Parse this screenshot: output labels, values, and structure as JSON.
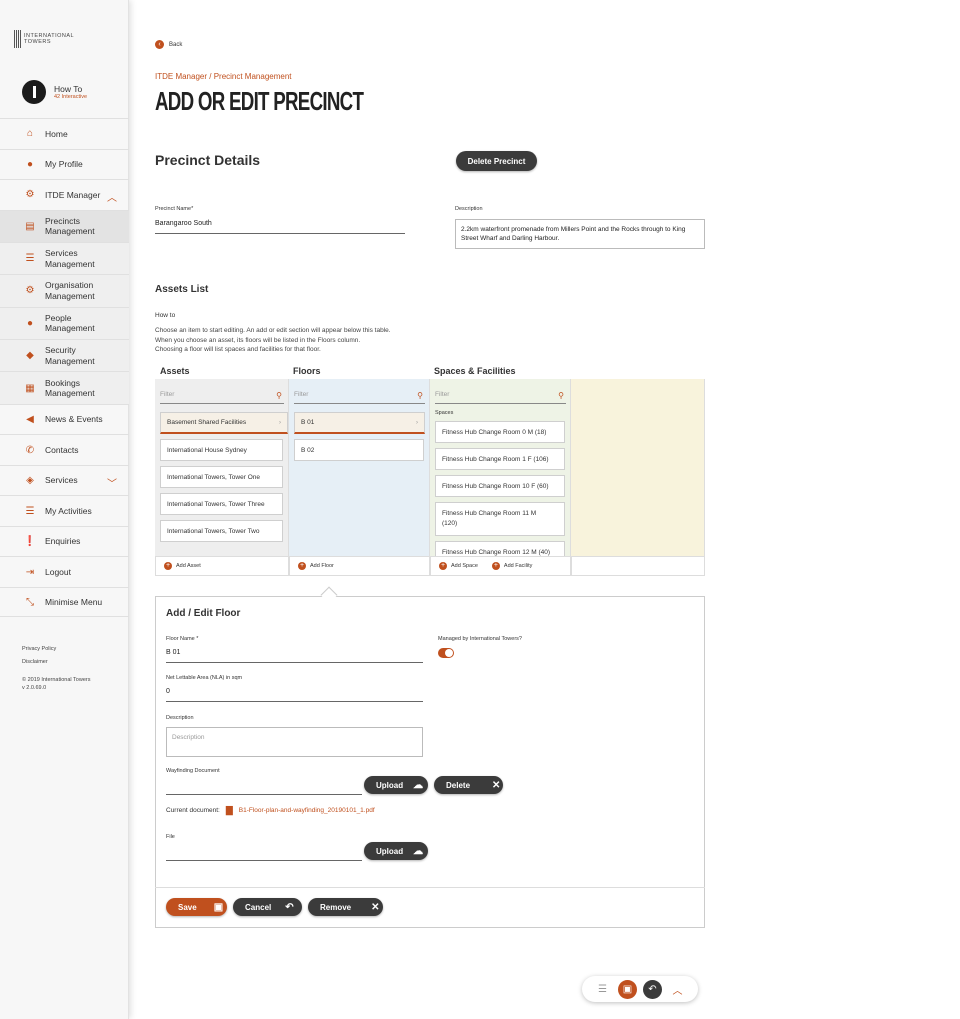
{
  "brand": {
    "logo_text_1": "INTERNATIONAL",
    "logo_text_2": "TOWERS"
  },
  "user": {
    "name": "How To",
    "org": "42 Interactive"
  },
  "nav": {
    "home": "Home",
    "profile": "My Profile",
    "itde": "ITDE Manager",
    "precincts_1": "Precincts",
    "precincts_2": "Management",
    "services_1": "Services",
    "services_2": "Management",
    "org_1": "Organisation",
    "org_2": "Management",
    "people_1": "People",
    "people_2": "Management",
    "security_1": "Security",
    "security_2": "Management",
    "bookings_1": "Bookings",
    "bookings_2": "Management",
    "news": "News & Events",
    "contacts": "Contacts",
    "services": "Services",
    "activities": "My Activities",
    "enquiries": "Enquiries",
    "logout": "Logout",
    "minimise": "Minimise Menu"
  },
  "footer": {
    "privacy": "Privacy Policy",
    "disclaimer": "Disclaimer",
    "copyright": "© 2019 International Towers",
    "version": "v 2.0.69.0"
  },
  "page": {
    "back": "Back",
    "breadcrumb": "ITDE Manager / Precinct Management",
    "title": "ADD OR EDIT PRECINCT",
    "details_heading": "Precinct Details",
    "delete_button": "Delete Precinct",
    "name_label": "Precinct Name*",
    "name_value": "Barangaroo South",
    "desc_label": "Description",
    "desc_value": "2.2km waterfront promenade from Millers Point and the Rocks through to King Street Wharf and Darling Harbour."
  },
  "assets": {
    "heading": "Assets List",
    "howto_label": "How to",
    "help_1": "Choose an item to start editing. An add or edit section will appear below this table.",
    "help_2": "When you choose an asset, its floors will be listed in the Floors column.",
    "help_3": "Choosing a floor will list spaces and facilities for that floor.",
    "col_assets": "Assets",
    "col_floors": "Floors",
    "col_spaces": "Spaces & Facilities",
    "filter_placeholder": "Filter",
    "asset_items": [
      "Basement Shared Facilities",
      "International House Sydney",
      "International Towers, Tower One",
      "International Towers, Tower Three",
      "International Towers, Tower Two"
    ],
    "floor_items": [
      "B 01",
      "B 02"
    ],
    "spaces_label": "Spaces",
    "space_items": [
      "Fitness Hub Change Room 0 M (18)",
      "Fitness Hub Change Room 1 F (106)",
      "Fitness Hub Change Room 10 F (60)",
      "Fitness Hub Change Room 11 M (120)",
      "Fitness Hub Change Room 12 M (40)"
    ],
    "add_asset": "Add Asset",
    "add_floor": "Add Floor",
    "add_space": "Add Space",
    "add_facility": "Add Facility"
  },
  "floor_form": {
    "heading": "Add / Edit Floor",
    "floor_name_label": "Floor Name *",
    "floor_name_value": "B 01",
    "managed_label": "Managed by International Towers?",
    "managed_on": true,
    "nla_label": "Net Lettable Area (NLA) in sqm",
    "nla_value": "0",
    "desc_label": "Description",
    "desc_placeholder": "Description",
    "wayfinding_label": "Wayfinding Document",
    "upload": "Upload",
    "delete": "Delete",
    "current_doc_label": "Current document:",
    "current_doc_name": "B1-Floor-plan-and-wayfinding_20190101_1.pdf",
    "file_label": "File",
    "save": "Save",
    "cancel": "Cancel",
    "remove": "Remove"
  },
  "colors": {
    "accent": "#c0501e",
    "dark": "#3b3b3b",
    "floors_bg": "#e6eff6",
    "spaces_bg": "#eef3e6",
    "extra_bg": "#f8f3dc"
  }
}
